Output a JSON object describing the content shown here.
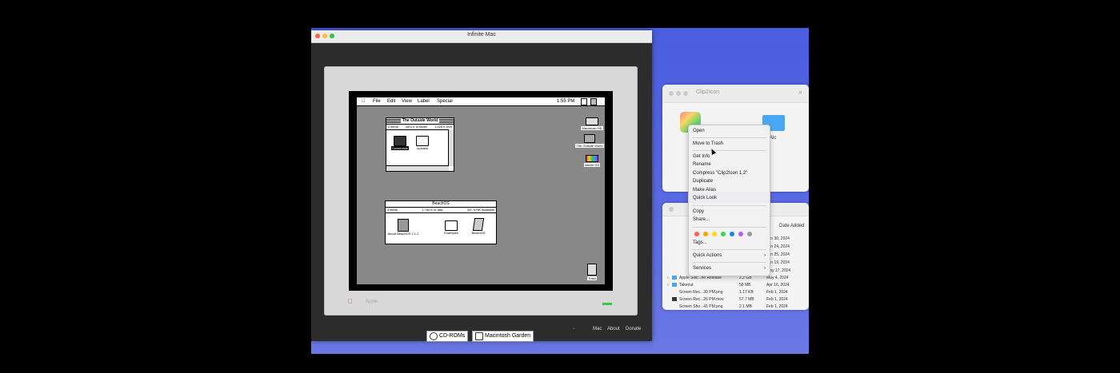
{
  "window": {
    "title": "Infinite Mac"
  },
  "mac": {
    "menubar": {
      "file": "File",
      "edit": "Edit",
      "view": "View",
      "label": "Label",
      "special": "Special",
      "time": "1:55 PM"
    },
    "win1": {
      "title": "The Outside World",
      "items": "2 items",
      "disk": "zero K in folder",
      "avail": "1,025 K free",
      "icons": [
        {
          "label": "Downloads"
        },
        {
          "label": "Uploads"
        }
      ]
    },
    "win2": {
      "title": "BeachOS",
      "items": "3 items",
      "disk": "1,750 K in disk",
      "avail": "347,979K available",
      "icons": [
        {
          "label": "About BeachOS 2.1.2"
        },
        {
          "label": "Examples"
        },
        {
          "label": "BeachOS"
        }
      ]
    },
    "desktop_icons": [
      {
        "label": "Macintosh HD"
      },
      {
        "label": "The Outside World"
      },
      {
        "label": "Infinite HD"
      },
      {
        "label": "Trash"
      }
    ],
    "footer_label": "Apple"
  },
  "bottom": {
    "cdroms": "CD-ROMs",
    "garden": "Macintosh Garden",
    "mac": "Mac",
    "about": "About",
    "donate": "Donate"
  },
  "finder": {
    "title": "Clip2Icon"
  },
  "context_menu": {
    "items": [
      "Open",
      "Move to Trash",
      "Get Info",
      "Rename",
      "Compress \"Clip2Icon 1.2\"",
      "Duplicate",
      "Make Alias",
      "Quick Look",
      "Copy",
      "Share...",
      "Tags...",
      "Quick Actions",
      "Services"
    ],
    "tag_colors": [
      "#ff5f57",
      "#ff9f0a",
      "#ffd60a",
      "#32d74b",
      "#0a84ff",
      "#bf5af2",
      "#98989d"
    ]
  },
  "list": {
    "header": "Date Added",
    "rows": [
      {
        "name": "Apple Silic...ne Release",
        "size": "2.2 GB",
        "date": "May 4, 2024"
      },
      {
        "name": "Takeout",
        "size": "58 MB",
        "date": "Apr 16, 2024"
      },
      {
        "name": "Screen Rec...30 PM.png",
        "size": "1.17 KB",
        "date": "Feb 1, 2024"
      },
      {
        "name": "Screen Rec...26 PM.mov",
        "size": "57.7 MB",
        "date": "Feb 1, 2024"
      },
      {
        "name": "Screen Sho...41 PM.png",
        "size": "2.1 MB",
        "date": "Feb 1, 2024"
      }
    ],
    "upper_dates": [
      "Jun 30, 2024",
      "Jun 24, 2024",
      "Jun 25, 2024",
      "Jun 19, 2024",
      "May 17, 2024"
    ]
  },
  "colors": {
    "desktop": "#5566dd",
    "mac_gray": "#888888",
    "power_led": "#2ecc40"
  }
}
